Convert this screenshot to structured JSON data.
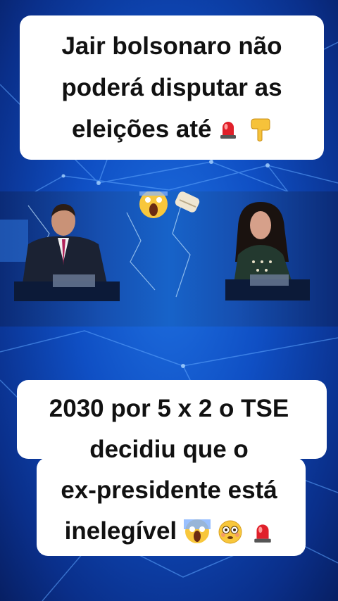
{
  "headline": {
    "line1": "Jair bolsonaro não",
    "line2": "poderá disputar as",
    "line3": "eleições até",
    "emoji": [
      "police-light-icon",
      "pointing-down-icon"
    ]
  },
  "video": {
    "overlay_emoji": [
      "screaming-face-icon",
      "scroll-icon"
    ],
    "anchors": [
      "male-anchor",
      "female-anchor"
    ]
  },
  "subtitle": {
    "line1": "2030 por 5 x 2 o TSE",
    "line2": "decidiu que o",
    "line3": "ex-presidente está",
    "line4": "inelegível",
    "emoji": [
      "screaming-face-icon",
      "flushed-face-icon",
      "police-light-icon"
    ]
  },
  "colors": {
    "background": "#0f4fc4",
    "caption_bg": "#ffffff",
    "text": "#111111"
  }
}
